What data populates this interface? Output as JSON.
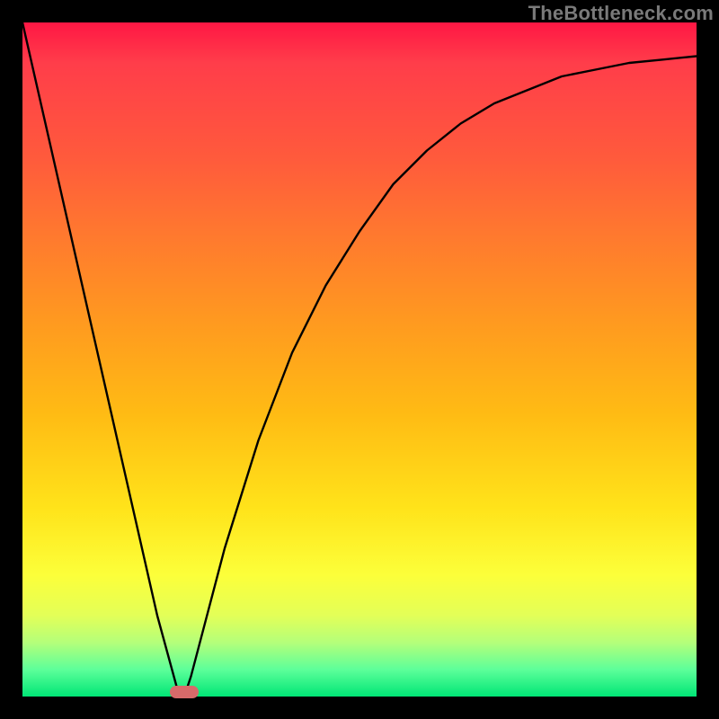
{
  "watermark": "TheBottleneck.com",
  "chart_data": {
    "type": "line",
    "title": "",
    "xlabel": "",
    "ylabel": "",
    "xlim": [
      0,
      100
    ],
    "ylim": [
      0,
      100
    ],
    "grid": false,
    "legend": false,
    "series": [
      {
        "name": "curve",
        "x": [
          0,
          5,
          10,
          15,
          20,
          23,
          24,
          25,
          30,
          35,
          40,
          45,
          50,
          55,
          60,
          65,
          70,
          75,
          80,
          85,
          90,
          95,
          100
        ],
        "y": [
          100,
          78,
          56,
          34,
          12,
          1,
          0,
          3,
          22,
          38,
          51,
          61,
          69,
          76,
          81,
          85,
          88,
          90,
          92,
          93,
          94,
          94.5,
          95
        ]
      }
    ],
    "marker": {
      "x_percent": 24,
      "color": "#d86a6a"
    },
    "colors": {
      "curve": "#000000",
      "background_top": "#ff1744",
      "background_bottom": "#00e676",
      "frame": "#000000"
    }
  }
}
